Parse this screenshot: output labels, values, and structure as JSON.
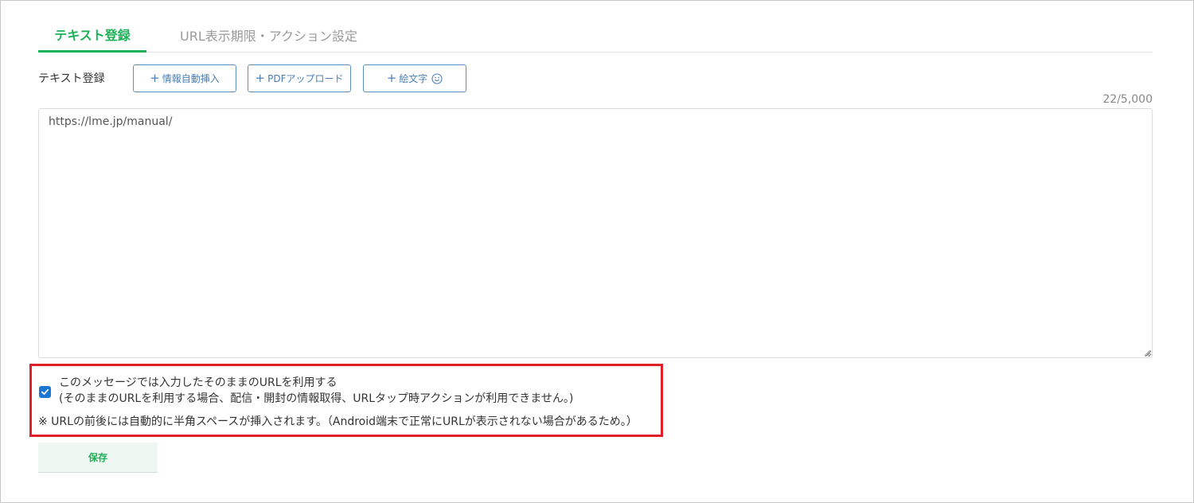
{
  "tabs": [
    {
      "label": "テキスト登録",
      "active": true
    },
    {
      "label": "URL表示期限・アクション設定",
      "active": false
    }
  ],
  "toolbar": {
    "label": "テキスト登録",
    "buttons": [
      {
        "label": "情報自動挿入",
        "icon": "plus-icon"
      },
      {
        "label": "PDFアップロード",
        "icon": "plus-icon"
      },
      {
        "label": "絵文字",
        "icon": "plus-icon",
        "trailing_icon": "smiley-icon"
      }
    ],
    "plus": "+"
  },
  "editor": {
    "counter": "22/5,000",
    "value": "https://lme.jp/manual/"
  },
  "url_option": {
    "checked": true,
    "line1": "このメッセージでは入力したそのままのURLを利用する",
    "line2": "(そのままのURLを利用する場合、配信・開封の情報取得、URLタップ時アクションが利用できません。)",
    "note": "※ URLの前後には自動的に半角スペースが挿入されます。（Android端末で正常にURLが表示されない場合があるため。）"
  },
  "save": {
    "label": "保存"
  },
  "colors": {
    "accent": "#1fb058",
    "button_outline": "#5a8fc0",
    "checkbox": "#1976d2",
    "highlight": "#e01f2a"
  }
}
